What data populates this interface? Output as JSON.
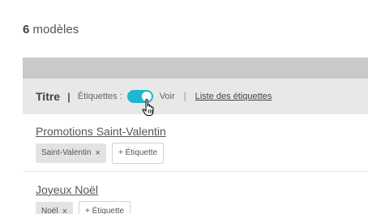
{
  "summary": {
    "count": "6",
    "label": " modèles"
  },
  "table_header": {
    "title_label": "Titre",
    "separator": "|",
    "tags_label": "Étiquettes :",
    "toggle_on": true,
    "toggle_label": "Voir",
    "thin_separator": "|",
    "tags_list_link": "Liste des étiquettes"
  },
  "items": [
    {
      "name": "Promotions Saint-Valentin",
      "tags": [
        {
          "label": "Saint-Valentin",
          "remove": "×"
        }
      ],
      "add_tag_label": "+ Étiquette"
    },
    {
      "name": "Joyeux Noël",
      "tags": [
        {
          "label": "Noël",
          "remove": "×"
        }
      ],
      "add_tag_label": "+ Étiquette"
    }
  ],
  "colors": {
    "toggle_on": "#1fb6d1",
    "header_bg": "#e8e8e8",
    "top_bar_bg": "#c9c9c9",
    "tag_bg": "#e3e3e3"
  }
}
